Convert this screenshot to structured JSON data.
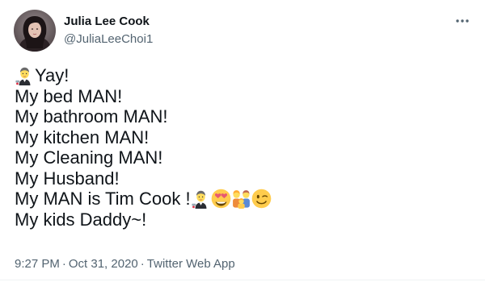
{
  "author": {
    "display_name": "Julia Lee Cook",
    "handle": "@JuliaLeeChoi1",
    "avatar_icon": "profile-photo"
  },
  "menu": {
    "more_icon": "ellipsis-icon"
  },
  "tweet": {
    "lines": [
      {
        "prefix_emoji": "man-technologist",
        "text": "Yay!"
      },
      {
        "text": "My bed MAN!"
      },
      {
        "text": "My bathroom MAN!"
      },
      {
        "text": "My kitchen MAN!"
      },
      {
        "text": "My Cleaning MAN!"
      },
      {
        "text": "My Husband!"
      },
      {
        "text": "My MAN is Tim Cook !",
        "suffix_emojis": [
          "man-technologist",
          "smiling-face-with-heart-eyes",
          "family",
          "winking-face"
        ]
      },
      {
        "text": "My kids Daddy~!"
      }
    ]
  },
  "meta": {
    "time": "9:27 PM",
    "separator1": "·",
    "date": "Oct 31, 2020",
    "separator2": "·",
    "source": "Twitter Web App"
  },
  "colors": {
    "text": "#0f1419",
    "secondary": "#536471",
    "divider": "#eff3f4"
  }
}
